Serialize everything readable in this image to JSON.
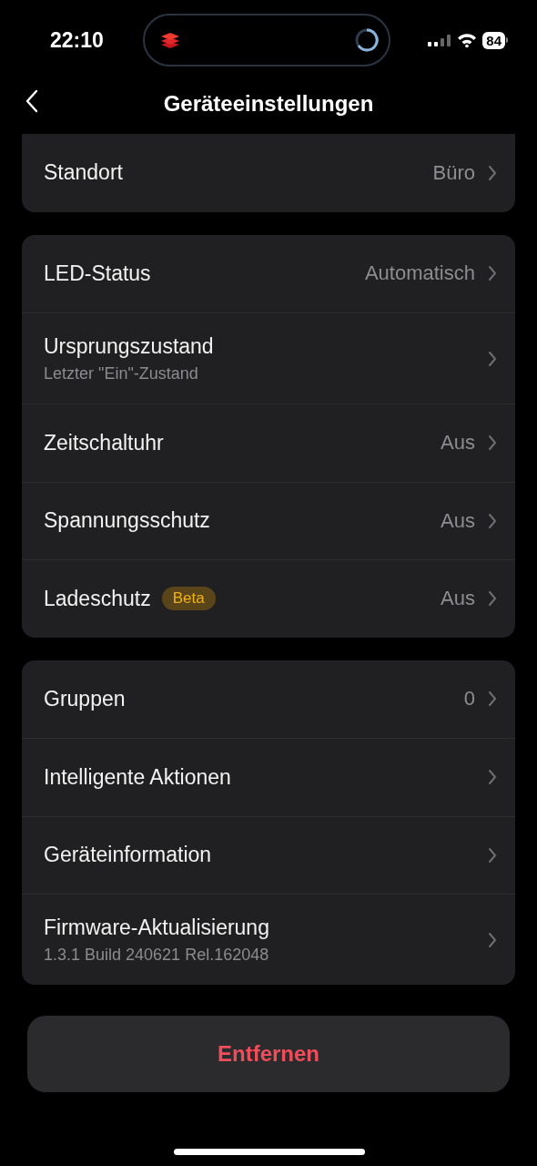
{
  "status_bar": {
    "time": "22:10",
    "battery": "84"
  },
  "header": {
    "title": "Geräteeinstellungen"
  },
  "sections": [
    {
      "cut_top": true,
      "rows": [
        {
          "label": "Standort",
          "value": "Büro"
        }
      ]
    },
    {
      "cut_top": false,
      "rows": [
        {
          "label": "LED-Status",
          "value": "Automatisch"
        },
        {
          "label": "Ursprungszustand",
          "subtitle": "Letzter \"Ein\"-Zustand"
        },
        {
          "label": "Zeitschaltuhr",
          "value": "Aus"
        },
        {
          "label": "Spannungsschutz",
          "value": "Aus"
        },
        {
          "label": "Ladeschutz",
          "badge": "Beta",
          "value": "Aus"
        }
      ]
    },
    {
      "cut_top": false,
      "rows": [
        {
          "label": "Gruppen",
          "value": "0"
        },
        {
          "label": "Intelligente Aktionen"
        },
        {
          "label": "Geräteinformation"
        },
        {
          "label": "Firmware-Aktualisierung",
          "subtitle": "1.3.1 Build 240621 Rel.162048"
        }
      ]
    }
  ],
  "remove_button": {
    "label": "Entfernen"
  }
}
